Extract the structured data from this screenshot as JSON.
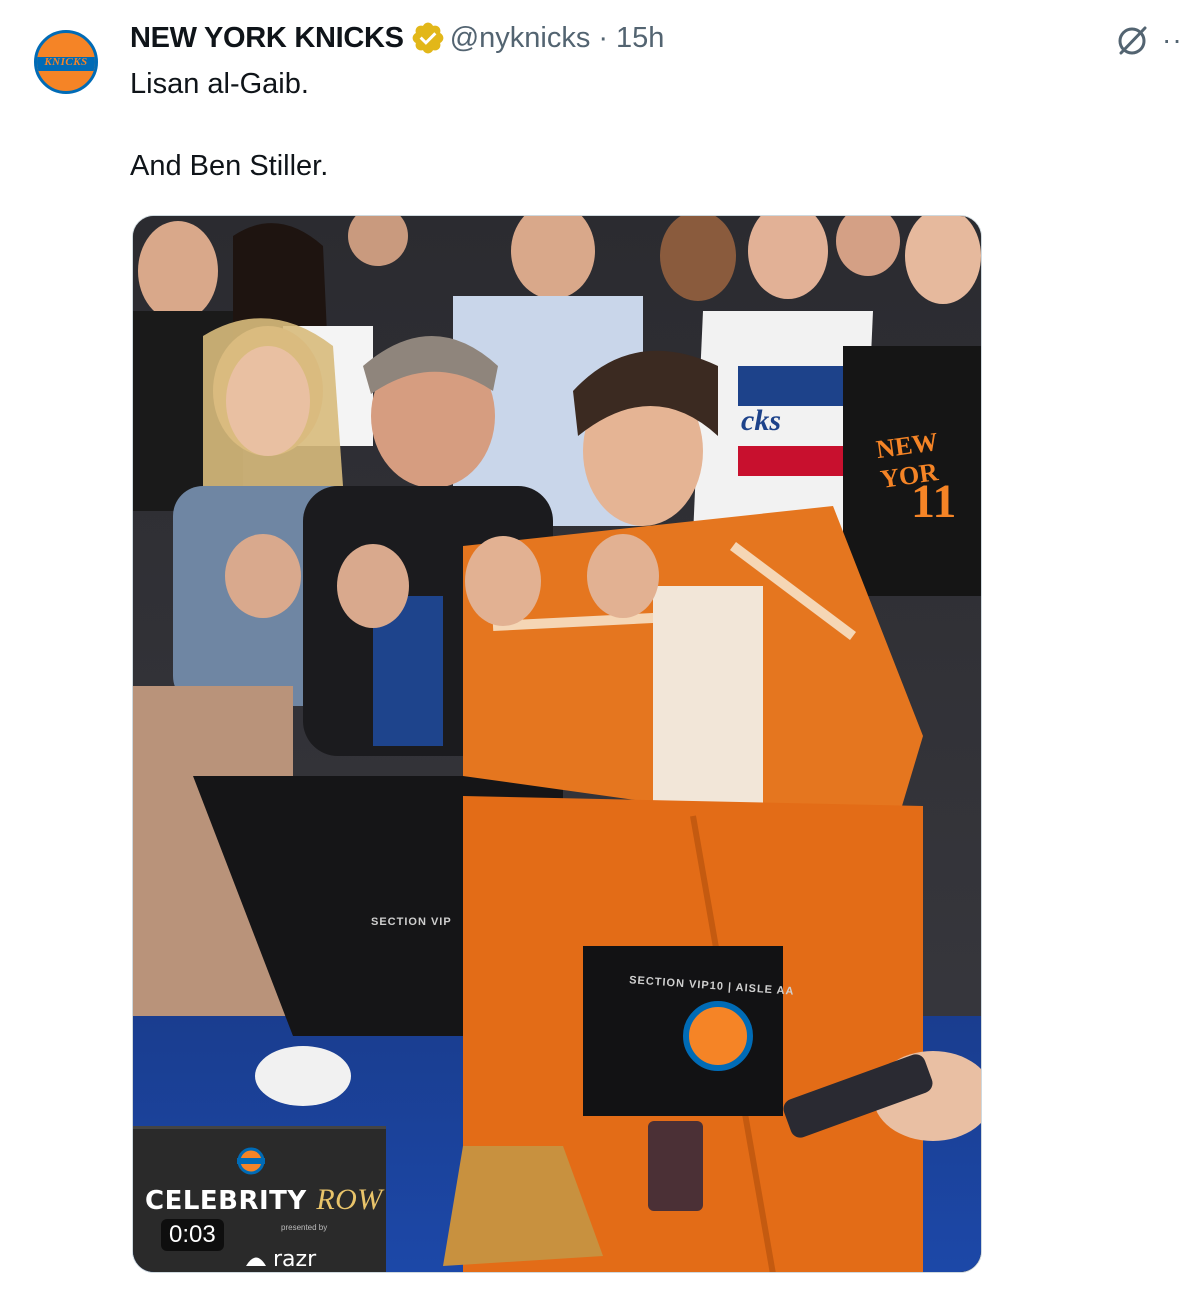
{
  "tweet": {
    "author_name": "NEW YORK KNICKS",
    "handle": "@nyknicks",
    "separator": "·",
    "time": "15h",
    "text_line1": "Lisan al-Gaib.",
    "text_line2": "And Ben Stiller.",
    "avatar_text": "KNICKS",
    "icons": [
      "verified-badge-icon",
      "grok-icon",
      "more-options-icon"
    ]
  },
  "media": {
    "type": "video",
    "overlay_title_a": "CELEBRITY",
    "overlay_title_b": "ROW",
    "timestamp": "0:03",
    "presented_by": "presented by",
    "sponsor": "razr",
    "jersey_text": "NEW YOR",
    "jersey_number": "11",
    "jacket_text": "cks",
    "seat_label": "SECTION VIP10 | AISLE AA",
    "seat_label_left": "SECTION VIP"
  },
  "colors": {
    "knicks_orange": "#f58426",
    "knicks_blue": "#006bb6",
    "verified_gold": "#e2b719",
    "muted_text": "#536471"
  }
}
